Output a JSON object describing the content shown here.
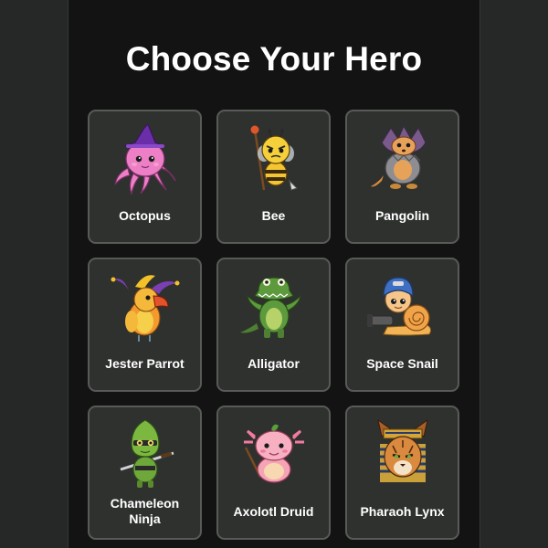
{
  "title": "Choose Your Hero",
  "heroes": [
    {
      "name": "Octopus",
      "icon": "octopus-wizard-icon"
    },
    {
      "name": "Bee",
      "icon": "bee-icon"
    },
    {
      "name": "Pangolin",
      "icon": "pangolin-icon"
    },
    {
      "name": "Jester Parrot",
      "icon": "jester-parrot-icon"
    },
    {
      "name": "Alligator",
      "icon": "alligator-icon"
    },
    {
      "name": "Space Snail",
      "icon": "space-snail-icon"
    },
    {
      "name": "Chameleon Ninja",
      "icon": "chameleon-ninja-icon"
    },
    {
      "name": "Axolotl Druid",
      "icon": "axolotl-druid-icon"
    },
    {
      "name": "Pharaoh Lynx",
      "icon": "pharaoh-lynx-icon"
    }
  ]
}
